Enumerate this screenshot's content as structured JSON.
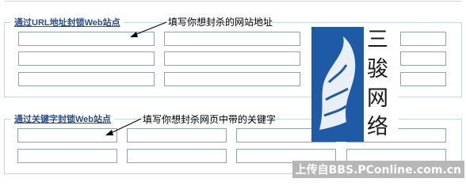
{
  "url_section": {
    "legend": "通过URL地址封锁Web站点",
    "annotation": "填写你想封杀的网站地址"
  },
  "keyword_section": {
    "legend": "通过关键字封锁Web站点",
    "annotation": "填写你想封杀网页中带的关键字"
  },
  "logo": {
    "chars": [
      "三",
      "骏",
      "网",
      "络"
    ],
    "brand_color": "#1f5aa6"
  },
  "watermark": "上传自BBS.PConline.com.cn"
}
